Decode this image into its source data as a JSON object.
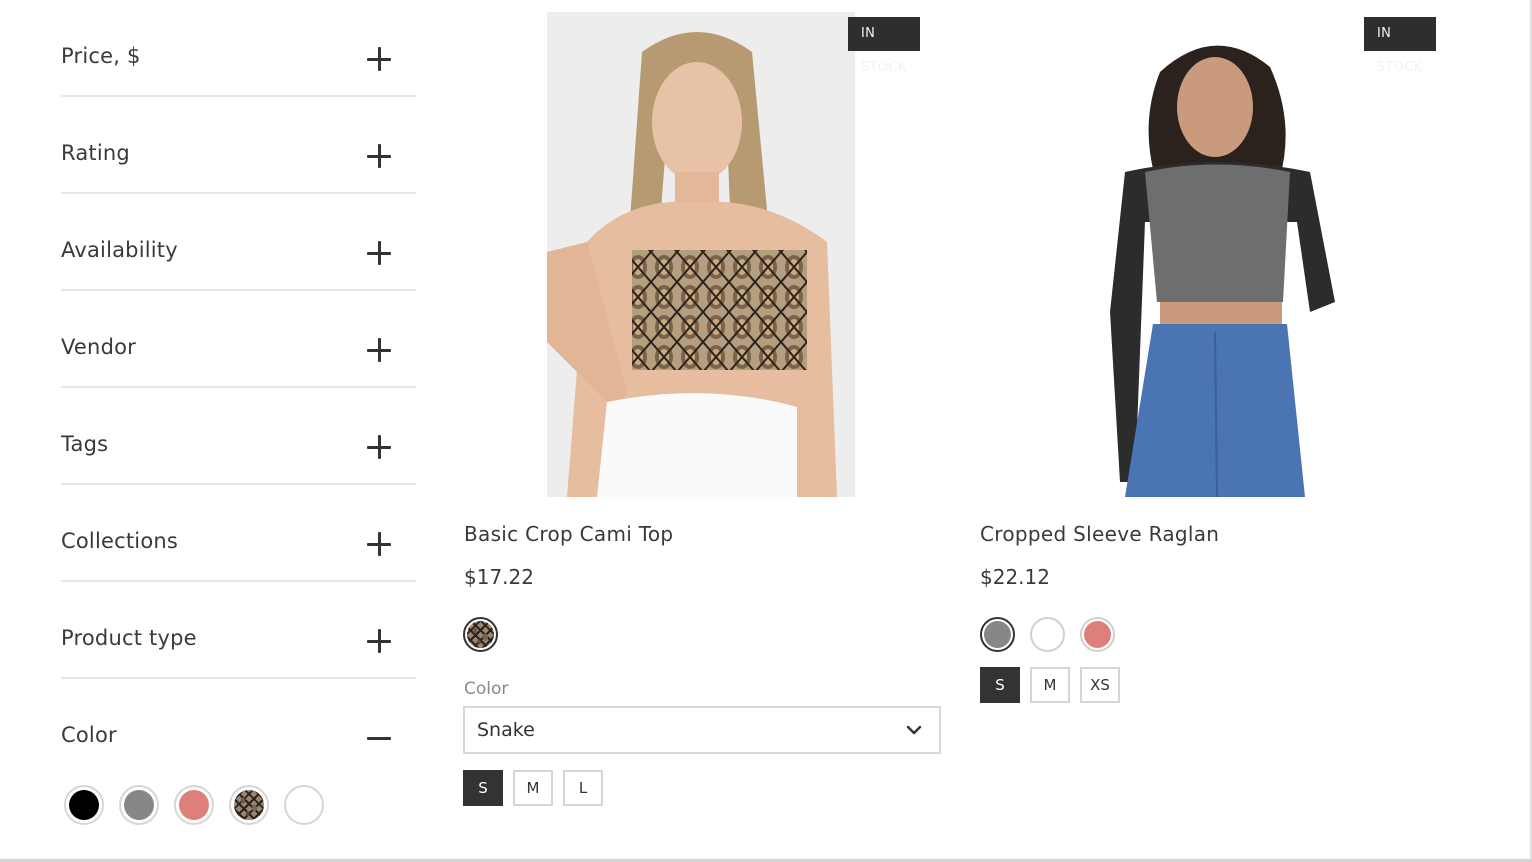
{
  "filters": [
    {
      "label": "Price, $",
      "state": "collapsed",
      "icon": "plus-icon"
    },
    {
      "label": "Rating",
      "state": "collapsed",
      "icon": "plus-icon"
    },
    {
      "label": "Availability",
      "state": "collapsed",
      "icon": "plus-icon"
    },
    {
      "label": "Vendor",
      "state": "collapsed",
      "icon": "plus-icon"
    },
    {
      "label": "Tags",
      "state": "collapsed",
      "icon": "plus-icon"
    },
    {
      "label": "Collections",
      "state": "collapsed",
      "icon": "plus-icon"
    },
    {
      "label": "Product type",
      "state": "collapsed",
      "icon": "plus-icon"
    },
    {
      "label": "Color",
      "state": "expanded",
      "icon": "minus-icon"
    }
  ],
  "color_filter_swatches": [
    {
      "name": "Black",
      "color": "#000000"
    },
    {
      "name": "Grey",
      "color": "#878787"
    },
    {
      "name": "Pink",
      "color": "#df7f7b"
    },
    {
      "name": "Snake",
      "color": "pattern"
    },
    {
      "name": "White",
      "color": "#ffffff"
    }
  ],
  "products": [
    {
      "badge": "IN STOCK",
      "title": "Basic Crop Cami Top",
      "price": "$17.22",
      "swatches": [
        {
          "name": "Snake",
          "color": "pattern",
          "selected": true
        }
      ],
      "color_label": "Color",
      "color_select_value": "Snake",
      "sizes": [
        {
          "label": "S",
          "active": true
        },
        {
          "label": "M",
          "active": false
        },
        {
          "label": "L",
          "active": false
        }
      ]
    },
    {
      "badge": "IN STOCK",
      "title": "Cropped Sleeve Raglan",
      "price": "$22.12",
      "swatches": [
        {
          "name": "Grey",
          "color": "#878787",
          "selected": true
        },
        {
          "name": "White",
          "color": "#ffffff",
          "selected": false
        },
        {
          "name": "Pink",
          "color": "#df7f7b",
          "selected": false
        }
      ],
      "sizes": [
        {
          "label": "S",
          "active": true
        },
        {
          "label": "M",
          "active": false
        },
        {
          "label": "XS",
          "active": false
        }
      ]
    }
  ]
}
